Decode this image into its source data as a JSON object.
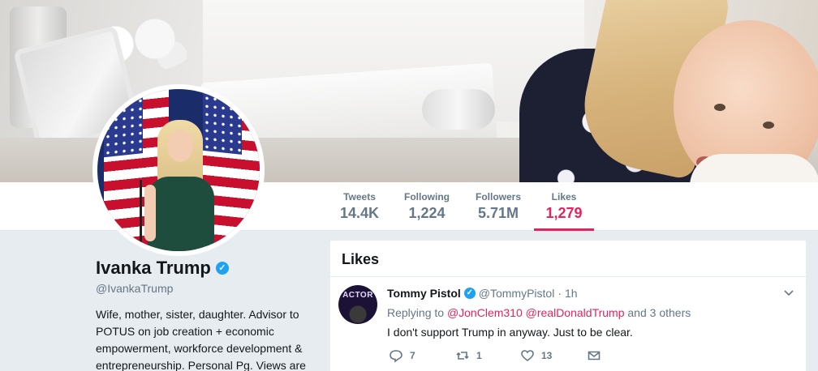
{
  "nav": {
    "stats": [
      {
        "label": "Tweets",
        "value": "14.4K"
      },
      {
        "label": "Following",
        "value": "1,224"
      },
      {
        "label": "Followers",
        "value": "5.71M"
      },
      {
        "label": "Likes",
        "value": "1,279"
      }
    ],
    "active_tab": "Likes"
  },
  "profile": {
    "name": "Ivanka Trump",
    "handle": "@IvankaTrump",
    "bio": "Wife, mother, sister, daughter. Advisor to POTUS on job creation + economic empowerment, workforce development & entrepreneurship. Personal Pg. Views are"
  },
  "likes_section": {
    "title": "Likes",
    "tweet": {
      "avatar_text": "ACTOR",
      "author": "Tommy Pistol",
      "handle": "@TommyPistol",
      "separator": "·",
      "time": "1h",
      "replying_prefix": "Replying to",
      "mention_1": "@JonClem310",
      "mention_2": "@realDonaldTrump",
      "replying_suffix": "and 3 others",
      "text": "I don't support Trump in anyway.  Just to be clear.",
      "reply_count": "7",
      "retweet_count": "1",
      "like_count": "13"
    }
  },
  "colors": {
    "accent": "#e0245e",
    "verified": "#1da1f2",
    "muted": "#657786",
    "background": "#e6ecf0"
  }
}
